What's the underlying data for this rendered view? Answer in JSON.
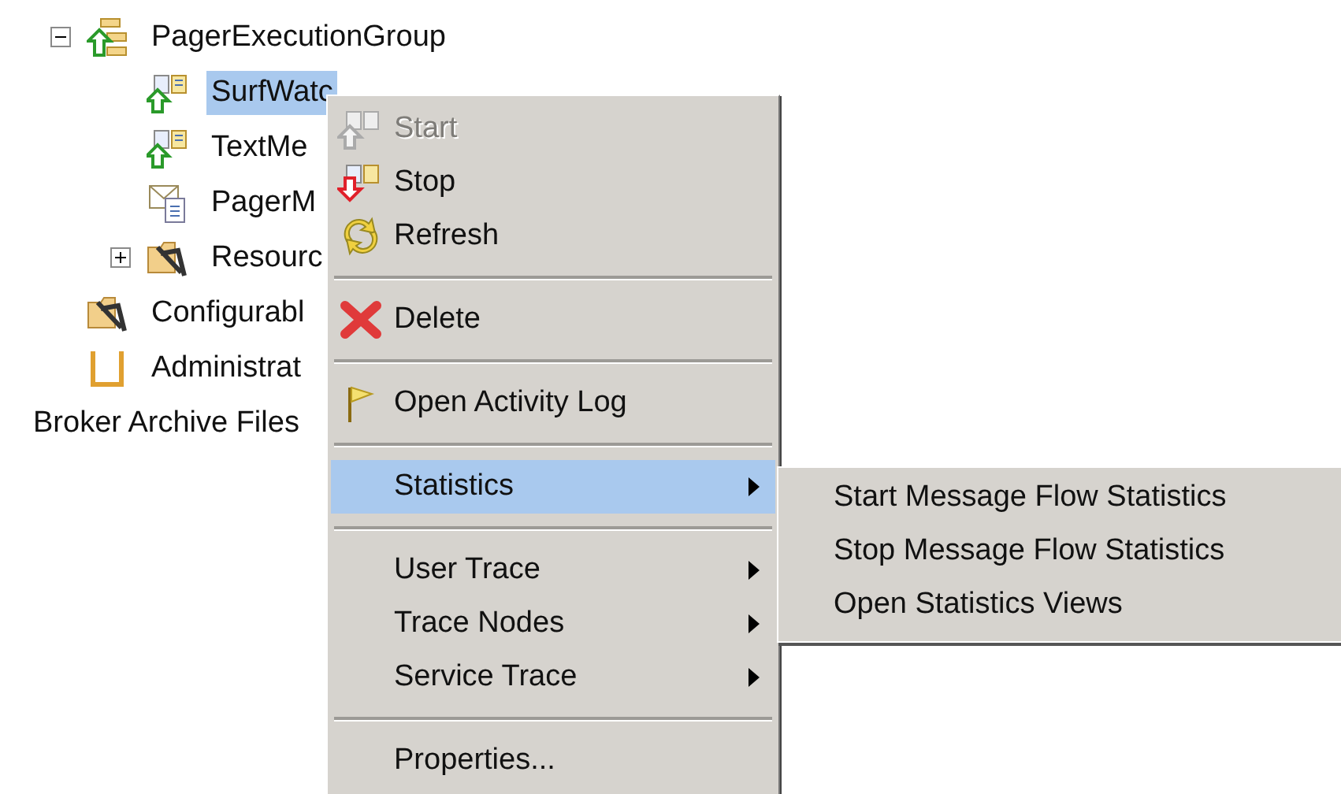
{
  "tree": [
    {
      "label": "PagerExecutionGroup",
      "kind": "group",
      "expanded": true,
      "children": [
        {
          "label": "SurfWatc",
          "kind": "flow",
          "selected": true
        },
        {
          "label": "TextMe",
          "kind": "flow",
          "selected": false
        },
        {
          "label": "PagerM",
          "kind": "set",
          "selected": false
        },
        {
          "label": "Resourc",
          "kind": "folder",
          "expanded": false,
          "selected": false
        }
      ],
      "selected": false
    },
    {
      "label": "Configurabl",
      "kind": "folder",
      "selected": false
    },
    {
      "label": "Administrat",
      "kind": "admin",
      "selected": false
    },
    {
      "label": "Broker Archive Files",
      "kind": "plain",
      "selected": false
    }
  ],
  "context_menu": {
    "items": [
      {
        "kind": "start",
        "label": "Start",
        "disabled": true,
        "selected": false
      },
      {
        "kind": "stop",
        "label": "Stop",
        "disabled": false,
        "selected": false
      },
      {
        "kind": "refresh",
        "label": "Refresh",
        "disabled": false,
        "selected": false
      },
      {
        "kind": "separator"
      },
      {
        "kind": "delete",
        "label": "Delete",
        "disabled": false,
        "selected": false
      },
      {
        "kind": "separator"
      },
      {
        "kind": "flag",
        "label": "Open Activity Log",
        "disabled": false,
        "selected": false
      },
      {
        "kind": "separator"
      },
      {
        "kind": "submenu",
        "label": "Statistics",
        "disabled": false,
        "selected": true
      },
      {
        "kind": "separator"
      },
      {
        "kind": "submenu",
        "label": "User Trace",
        "disabled": false,
        "selected": false
      },
      {
        "kind": "submenu",
        "label": "Trace Nodes",
        "disabled": false,
        "selected": false
      },
      {
        "kind": "submenu",
        "label": "Service Trace",
        "disabled": false,
        "selected": false
      },
      {
        "kind": "separator"
      },
      {
        "kind": "plain",
        "label": "Properties...",
        "disabled": false,
        "selected": false
      }
    ]
  },
  "submenu": {
    "items": [
      {
        "label": "Start Message Flow Statistics",
        "selected": false
      },
      {
        "label": "Stop Message Flow Statistics",
        "selected": false
      },
      {
        "label": "Open Statistics Views",
        "selected": false
      }
    ]
  }
}
